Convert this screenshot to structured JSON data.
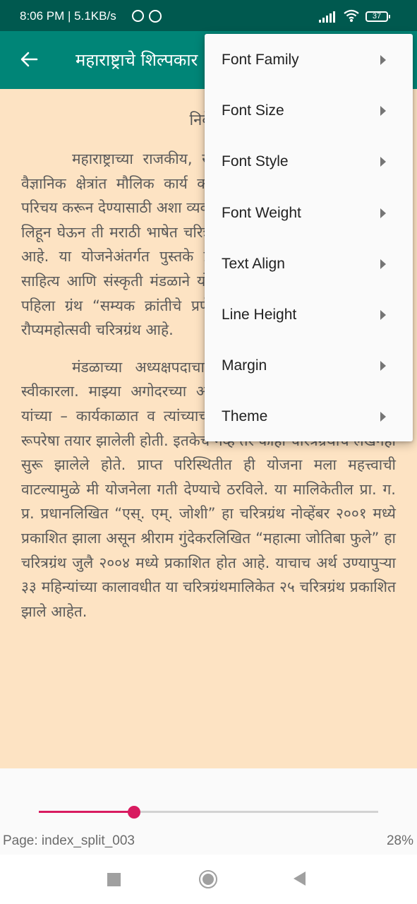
{
  "status_bar": {
    "time_speed": "8:06 PM | 5.1KB/s",
    "battery": "37",
    "icons": [
      "alarm-icon",
      "whatsapp-icon",
      "signal-icon",
      "wifi-icon",
      "battery-icon"
    ]
  },
  "toolbar": {
    "back_icon": "arrow-left-icon",
    "title": "महाराष्ट्राचे शिल्पकार"
  },
  "content": {
    "heading": "निवेदन",
    "paragraphs": [
      "महाराष्ट्राच्या राजकीय, सामाजिक, सांस्कृतिक, आर्थिक व वैज्ञानिक क्षेत्रांत मौलिक कार्य करणाऱ्या दिवंगत महनीय व्यक्तींचा परिचय करून देण्यासाठी अशा व्यक्तींची साधारणतः शंभर पृष्ठांची चरित्रे लिहून घेऊन ती मराठी भाषेत चरित्रे लिहून प्रकाशित करण्याची योजना आहे. या योजनेअंतर्गत पुस्तके प्रकाशित करण्याची महाराष्ट्र राज्य साहित्य आणि संस्कृती मंडळाने योजना आखली आहे. या योजनेतील पहिला ग्रंथ “सम्यक क्रांतीचे प्रणेते : महात्मा जोतीराव फुले” हा रौप्यमहोत्सवी चरित्रग्रंथ आहे.",
      "मंडळाच्या अध्यक्षपदाचा कार्यभार मी ... २००० रोजी स्वीकारला. माझ्या अगोदरच्या अध्यक्षांच्या – प्रा. सुरेश द्वादशीवार यांच्या – कार्यकाळात व त्यांच्याच पुढाकाराने या चरित्रग्रंथमालिकेची रूपरेषा तयार झालेली होती. इतकेच नव्हे तर काही चरित्रग्रंथांचे लेखनही सुरू झालेले होते. प्राप्त परिस्थितीत ही योजना मला महत्त्वाची वाटल्यामुळे मी योजनेला गती देण्याचे ठरविले. या मालिकेतील प्रा. ग. प्र. प्रधानलिखित “एस्. एम्. जोशी” हा चरित्रग्रंथ नोव्हेंबर २००१ मध्ये प्रकाशित झाला असून श्रीराम गुंदेकरलिखित “महात्मा जोतिबा फुले” हा चरित्रग्रंथ जुलै २००४ मध्ये प्रकाशित होत आहे. याचाच अर्थ उण्यापुऱ्या ३३ महिन्यांच्या कालावधीत या चरित्रग्रंथमालिकेत २५ चरित्रग्रंथ प्रकाशित झाले आहेत."
    ]
  },
  "menu": {
    "items": [
      {
        "label": "Font Family",
        "icon": "chevron-right-icon"
      },
      {
        "label": "Font Size",
        "icon": "chevron-right-icon"
      },
      {
        "label": "Font Style",
        "icon": "chevron-right-icon"
      },
      {
        "label": "Font Weight",
        "icon": "chevron-right-icon"
      },
      {
        "label": "Text Align",
        "icon": "chevron-right-icon"
      },
      {
        "label": "Line Height",
        "icon": "chevron-right-icon"
      },
      {
        "label": "Margin",
        "icon": "chevron-right-icon"
      },
      {
        "label": "Theme",
        "icon": "chevron-right-icon"
      }
    ]
  },
  "progress": {
    "page_label": "Page: index_split_003",
    "percent_label": "28%",
    "slider_value": 0.28,
    "accent_color": "#d81b60",
    "track_color": "#d2d2d2"
  },
  "colors": {
    "status_bar": "#00594f",
    "toolbar": "#008577",
    "page_background": "#fde3c3"
  },
  "nav_bar": {
    "buttons": [
      "recent-apps",
      "home",
      "back"
    ]
  }
}
